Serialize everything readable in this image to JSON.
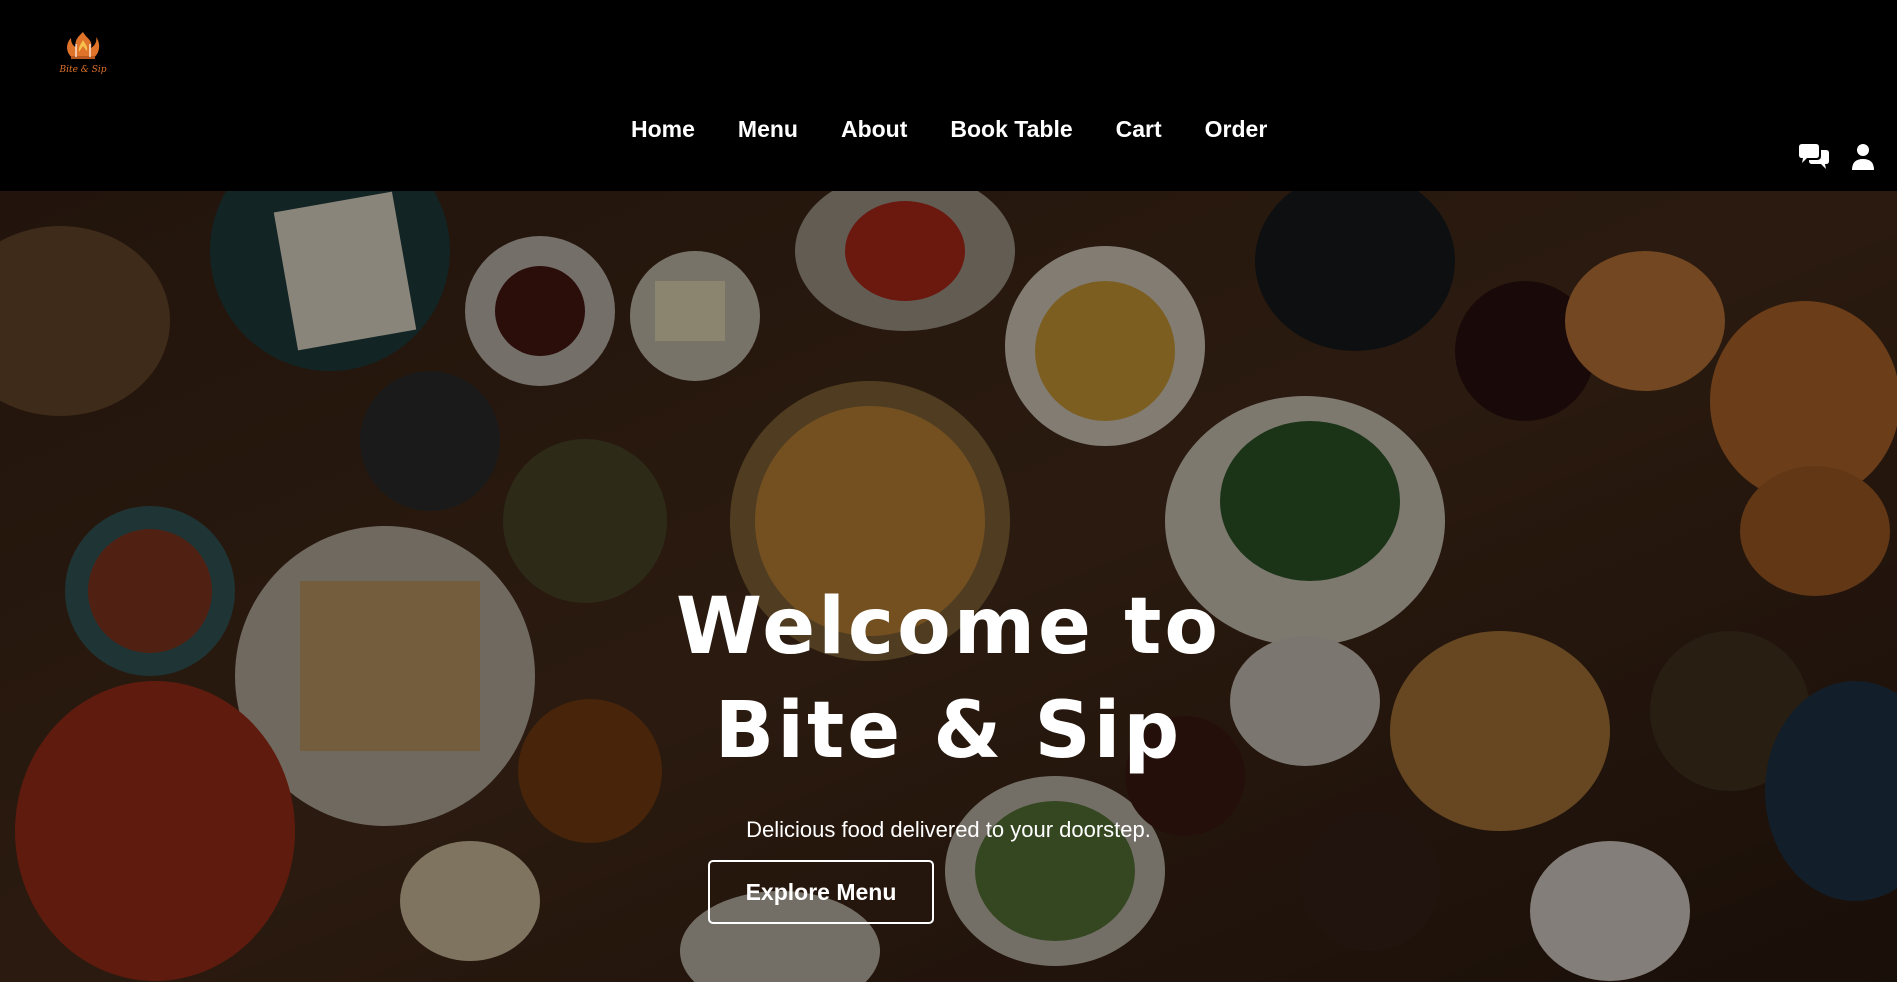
{
  "brand": {
    "name": "Bite & Sip",
    "logo_icon": "flame-fork-logo-icon"
  },
  "nav": {
    "items": [
      {
        "label": "Home"
      },
      {
        "label": "Menu"
      },
      {
        "label": "About"
      },
      {
        "label": "Book Table"
      },
      {
        "label": "Cart"
      },
      {
        "label": "Order"
      }
    ]
  },
  "header_icons": {
    "chat": "chat-bubbles-icon",
    "user": "user-icon"
  },
  "hero": {
    "title_line1": "Welcome to",
    "title_line2": "Bite & Sip",
    "subtitle": "Delicious food delivered to your doorstep.",
    "cta_label": "Explore Menu",
    "background": "overhead-food-table-photo"
  },
  "colors": {
    "header_bg": "#000000",
    "text": "#ffffff",
    "logo_accent": "#e0732a"
  }
}
